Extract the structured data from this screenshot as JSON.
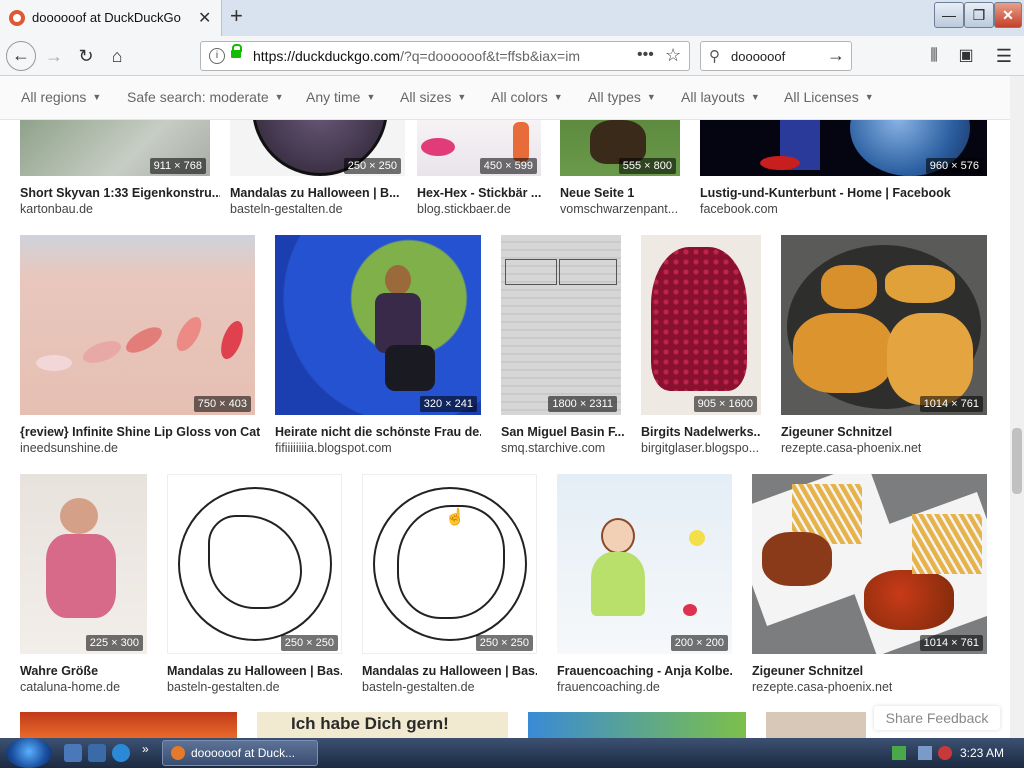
{
  "tab": {
    "title": "doooooof at DuckDuckGo",
    "close": "✕",
    "new": "+"
  },
  "window": {
    "minimize": "—",
    "maximize": "❐",
    "close": "✕"
  },
  "nav": {
    "url_host": "https://duckduckgo.com",
    "url_rest": "/?q=doooooof&t=ffsb&iax=im",
    "search_value": "doooooof",
    "more": "•••",
    "star": "☆"
  },
  "filters": [
    "All regions",
    "Safe search: moderate",
    "Any time",
    "All sizes",
    "All colors",
    "All types",
    "All layouts",
    "All Licenses"
  ],
  "results": [
    {
      "title": "Short Skyvan 1:33 Eigenkonstru...",
      "source": "kartonbau.de",
      "dims": "911 × 768"
    },
    {
      "title": "Mandalas zu Halloween | B...",
      "source": "basteln-gestalten.de",
      "dims": "250 × 250"
    },
    {
      "title": "Hex-Hex - Stickbär ...",
      "source": "blog.stickbaer.de",
      "dims": "450 × 599"
    },
    {
      "title": "Neue Seite 1",
      "source": "vomschwarzenpant...",
      "dims": "555 × 800"
    },
    {
      "title": "Lustig-und-Kunterbunt - Home | Facebook",
      "source": "facebook.com",
      "dims": "960 × 576"
    },
    {
      "title": "{review} Infinite Shine Lip Gloss von Cat...",
      "source": "ineedsunshine.de",
      "dims": "750 × 403"
    },
    {
      "title": "Heirate nicht die schönste Frau de...",
      "source": "fifiiiiiiiia.blogspot.com",
      "dims": "320 × 241"
    },
    {
      "title": "San Miguel Basin F...",
      "source": "smq.starchive.com",
      "dims": "1800 × 2311"
    },
    {
      "title": "Birgits Nadelwerks...",
      "source": "birgitglaser.blogspo...",
      "dims": "905 × 1600"
    },
    {
      "title": "Zigeuner Schnitzel",
      "source": "rezepte.casa-phoenix.net",
      "dims": "1014 × 761"
    },
    {
      "title": "Wahre Größe",
      "source": "cataluna-home.de",
      "dims": "225 × 300"
    },
    {
      "title": "Mandalas zu Halloween | Bas...",
      "source": "basteln-gestalten.de",
      "dims": "250 × 250"
    },
    {
      "title": "Mandalas zu Halloween | Bas...",
      "source": "basteln-gestalten.de",
      "dims": "250 × 250"
    },
    {
      "title": "Frauencoaching - Anja Kolbe...",
      "source": "frauencoaching.de",
      "dims": "200 × 200"
    },
    {
      "title": "Zigeuner Schnitzel",
      "source": "rezepte.casa-phoenix.net",
      "dims": "1014 × 761"
    }
  ],
  "peek_text": "Ich habe Dich gern!",
  "share_feedback": "Share Feedback",
  "taskbar": {
    "item_label": "doooooof at Duck...",
    "clock": "3:23 AM"
  }
}
